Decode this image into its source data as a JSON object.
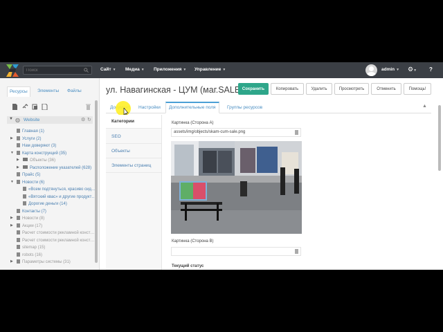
{
  "topbar": {
    "search_placeholder": "Поиск",
    "menus": [
      "Сайт",
      "Медиа",
      "Приложения",
      "Управление"
    ],
    "user": "admin",
    "help": "?"
  },
  "sidebar": {
    "tabs": [
      "Ресурсы",
      "Элементы",
      "Файлы"
    ],
    "site": "Website",
    "tree": [
      "Главная (1)",
      "Услуги (2)",
      "Нам доверяют (3)",
      "Карта конструкций (35)",
      "Объекты (36)",
      "Расположение указателей (628)",
      "Прайс (5)",
      "Новости (6)",
      "«Всем подтянуться, красиво сид…",
      "«Вятский квас» и другие продукт…",
      "Дорогие деньги (14)",
      "Контакты (7)",
      "Новости (8)",
      "Акции (17)",
      "Расчет стоимости рекламной конст…",
      "Расчет стоимости рекламной конст…",
      "sitemap (15)",
      "robots (16)",
      "Параметры системы (31)"
    ]
  },
  "main": {
    "title": "ул. Навагинская - ЦУМ (маг.SALE)",
    "buttons": [
      "Сохранить",
      "Копировать",
      "Удалить",
      "Просмотреть",
      "Отменить",
      "Помощь!"
    ],
    "tabs": [
      "Документ",
      "Настройки",
      "Дополнительные поля",
      "Группы ресурсов"
    ],
    "categories": [
      "Категории",
      "SEO",
      "Объекты",
      "Элементы страниц"
    ],
    "fields": {
      "side_a_label": "Картинка (Сторона А)",
      "side_a_value": "assets/img/objects/skam-cum-sale.png",
      "side_b_label": "Картинка (Сторона В)",
      "side_b_value": "",
      "status_label": "Текущий статус"
    }
  },
  "colors": {
    "topbar": "#3b3f45",
    "accent": "#2ea68a",
    "link": "#4a8ec2"
  }
}
